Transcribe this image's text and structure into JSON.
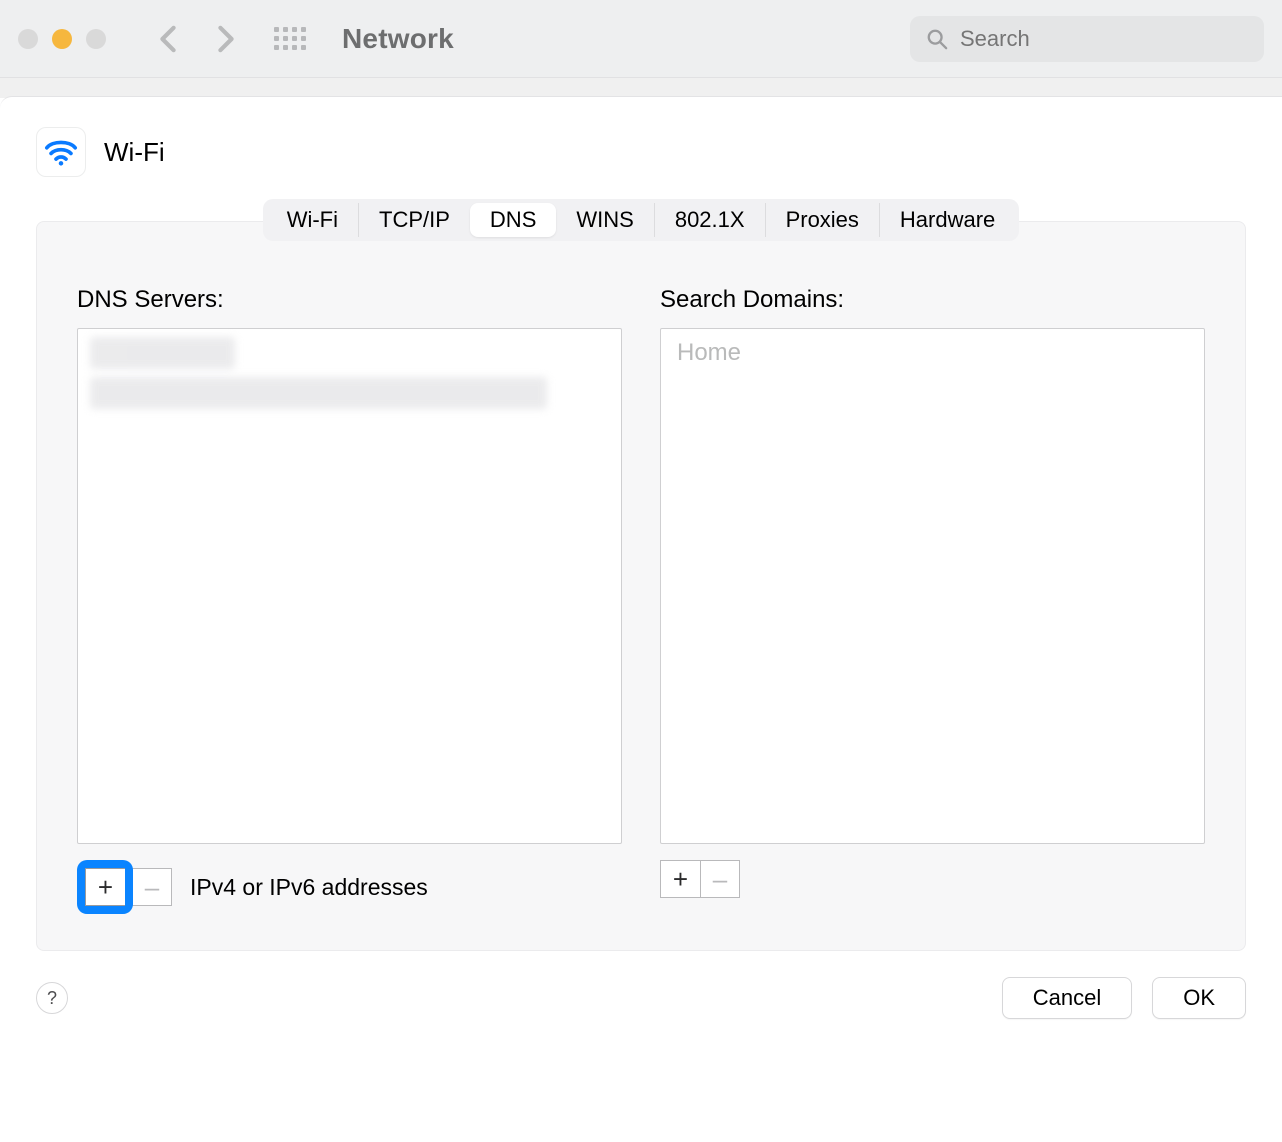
{
  "window": {
    "title": "Network",
    "search_placeholder": "Search"
  },
  "connection": {
    "name": "Wi-Fi"
  },
  "tabs": {
    "items": [
      {
        "label": "Wi-Fi",
        "active": false
      },
      {
        "label": "TCP/IP",
        "active": false
      },
      {
        "label": "DNS",
        "active": true
      },
      {
        "label": "WINS",
        "active": false
      },
      {
        "label": "802.1X",
        "active": false
      },
      {
        "label": "Proxies",
        "active": false
      },
      {
        "label": "Hardware",
        "active": false
      }
    ]
  },
  "dns": {
    "servers_label": "DNS Servers:",
    "footer_hint": "IPv4 or IPv6 addresses"
  },
  "domains": {
    "label": "Search Domains:",
    "placeholder_item": "Home"
  },
  "buttons": {
    "plus": "+",
    "minus": "–",
    "cancel": "Cancel",
    "ok": "OK",
    "help": "?"
  }
}
